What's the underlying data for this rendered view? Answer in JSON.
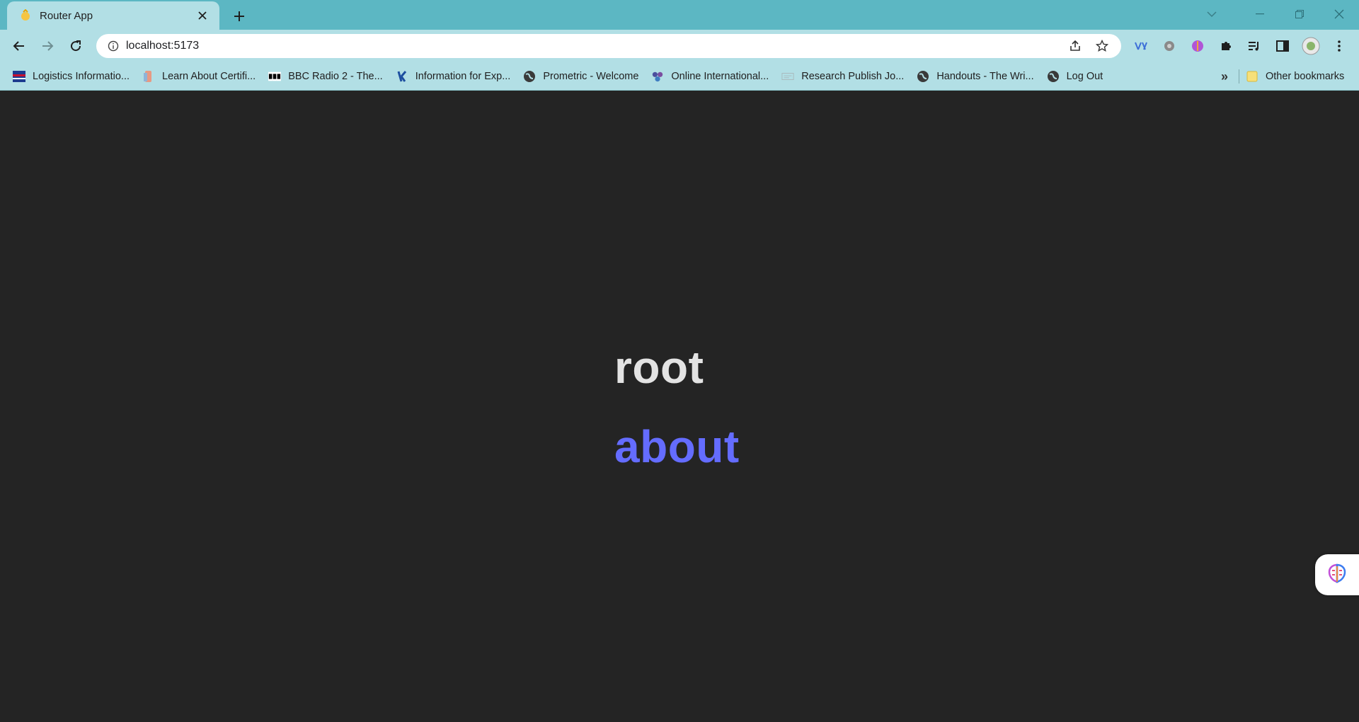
{
  "browser": {
    "tab": {
      "title": "Router App",
      "favicon": "vite-icon"
    },
    "new_tab_label": "+",
    "address": {
      "url": "localhost:5173"
    },
    "bookmarks": [
      {
        "label": "Logistics Informatio...",
        "icon": "flag-icon"
      },
      {
        "label": "Learn About Certifi...",
        "icon": "certificate-icon"
      },
      {
        "label": "BBC Radio 2 - The...",
        "icon": "bbc-icon"
      },
      {
        "label": "Information for Exp...",
        "icon": "k-logo-icon"
      },
      {
        "label": "Prometric - Welcome",
        "icon": "globe-icon"
      },
      {
        "label": "Online International...",
        "icon": "hex-logo-icon"
      },
      {
        "label": "Research Publish Jo...",
        "icon": "journal-icon"
      },
      {
        "label": "Handouts - The Wri...",
        "icon": "globe-icon"
      },
      {
        "label": "Log Out",
        "icon": "globe-icon"
      }
    ],
    "bookmarks_more": "»",
    "other_bookmarks": "Other bookmarks"
  },
  "page": {
    "links": [
      {
        "label": "root",
        "color": "#e3e3e3"
      },
      {
        "label": "about",
        "color": "#646cff"
      }
    ],
    "background": "#242424"
  },
  "colors": {
    "tabstrip": "#5cb7c3",
    "toolbar": "#b2dfe5",
    "accent": "#646cff"
  }
}
